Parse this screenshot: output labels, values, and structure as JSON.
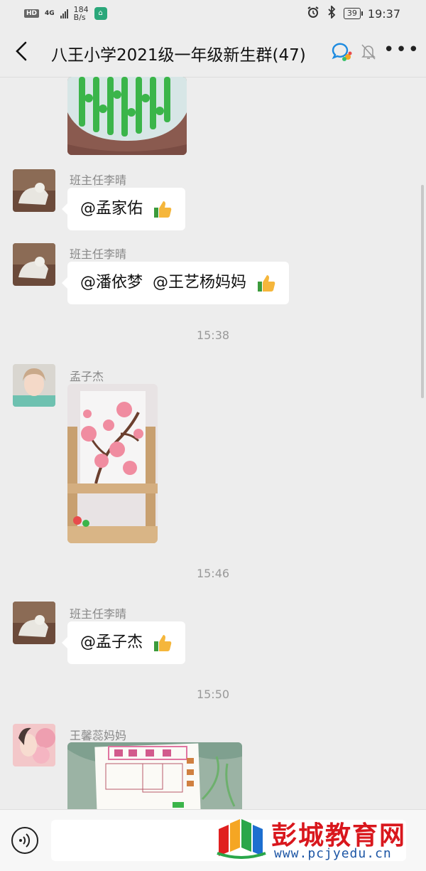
{
  "status_bar": {
    "hd": "HD",
    "net_type": "4G",
    "speed_value": "184",
    "speed_unit": "B/s",
    "battery": "39",
    "time": "19:37"
  },
  "header": {
    "title": "八王小学2021级一年级新生群(47)"
  },
  "messages": [
    {
      "sender": "班主任李晴",
      "text": "@孟家佑"
    },
    {
      "sender": "班主任李晴",
      "text": "@潘依梦  @王艺杨妈妈"
    },
    {
      "time": "15:38"
    },
    {
      "sender": "孟子杰"
    },
    {
      "time": "15:46"
    },
    {
      "sender": "班主任李晴",
      "text": "@孟子杰"
    },
    {
      "time": "15:50"
    },
    {
      "sender": "王馨蕊妈妈"
    }
  ],
  "input": {
    "placeholder": ""
  },
  "watermark": {
    "name": "彭城教育网",
    "url": "www.pcjyedu.cn"
  },
  "colors": {
    "background": "#ededed",
    "bubble": "#ffffff",
    "watermark_red": "#d9171d",
    "watermark_blue": "#1d56a5"
  }
}
